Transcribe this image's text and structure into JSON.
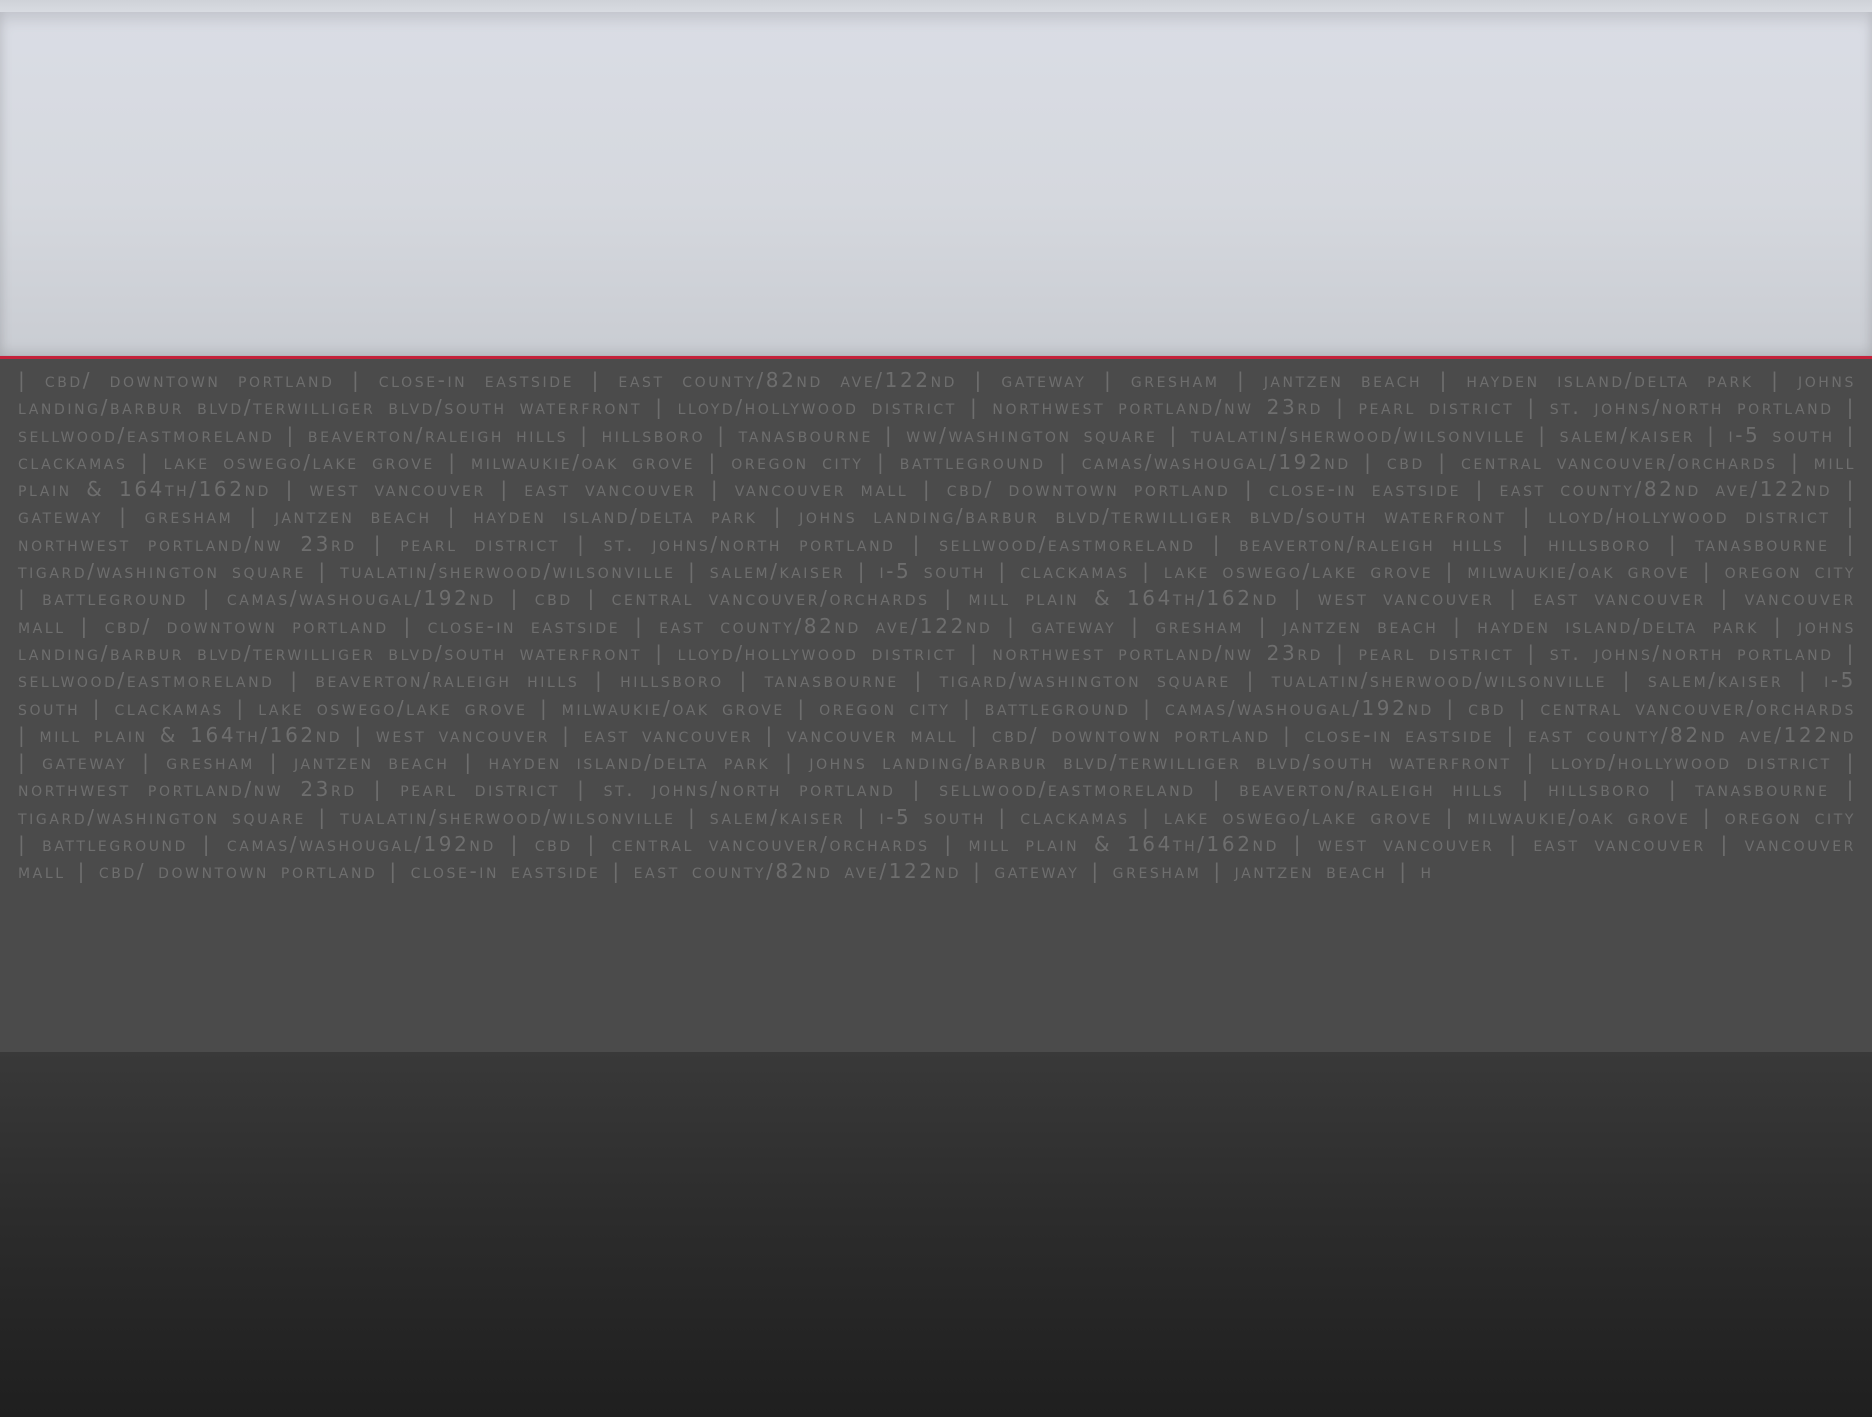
{
  "colors": {
    "header_background": "#d8dbe1",
    "accent_rule": "#c4213a",
    "panel_background": "#4b4b4b",
    "panel_text": "#6e6e6e",
    "footer_background": "#2b2b2b"
  },
  "neighborhoods": {
    "text": "| CBD/ DOWNTOWN PORTLAND | CLOSE-IN EASTSIDE | EAST COUNTY/82ND AVE/122ND | GATEWAY | GRESHAM | JANTZEN BEACH | HAYDEN ISLAND/DELTA PARK | JOHNS LANDING/BARBUR BLVD/TERWILLIGER BLVD/SOUTH WATERFRONT | LLOYD/HOLLYWOOD DISTRICT | NORTHWEST PORTLAND/NW 23RD | PEARL DISTRICT | ST. JOHNS/NORTH PORTLAND | SELLWOOD/EASTMORELAND | BEAVERTON/RALEIGH HILLS | HILLSBORO | TANASBOURNE | WW/WASHINGTON SQUARE | TUALATIN/SHERWOOD/WILSONVILLE | SALEM/KAISER | I-5 SOUTH | CLACKAMAS | LAKE OSWEGO/LAKE GROVE | MILWAUKIE/OAK GROVE | OREGON CITY | BATTLEGROUND | CAMAS/WASHOUGAL/192ND | CBD | CENTRAL VANCOUVER/ORCHARDS | MILL PLAIN & 164TH/162ND | WEST VANCOUVER | EAST VANCOUVER | VANCOUVER MALL | CBD/ DOWNTOWN PORTLAND | CLOSE-IN EASTSIDE | EAST COUNTY/82ND AVE/122ND | GATEWAY | GRESHAM | JANTZEN BEACH | HAYDEN ISLAND/DELTA PARK | JOHNS LANDING/BARBUR BLVD/TERWILLIGER BLVD/SOUTH WATERFRONT | LLOYD/HOLLYWOOD DISTRICT | NORTHWEST PORTLAND/NW 23RD | PEARL DISTRICT | ST. JOHNS/NORTH PORTLAND | SELLWOOD/EASTMORELAND | BEAVERTON/RALEIGH HILLS | HILLSBORO | TANASBOURNE | TIGARD/WASHINGTON SQUARE | TUALATIN/SHERWOOD/WILSONVILLE | SALEM/KAISER | I-5 SOUTH | CLACKAMAS | LAKE OSWEGO/LAKE GROVE | MILWAUKIE/OAK GROVE | OREGON CITY | BATTLEGROUND | CAMAS/WASHOUGAL/192ND | CBD | CENTRAL VANCOUVER/ORCHARDS | MILL PLAIN & 164TH/162ND | WEST VANCOUVER | EAST VANCOUVER | VANCOUVER MALL | CBD/ DOWNTOWN PORTLAND | CLOSE-IN EASTSIDE | EAST COUNTY/82ND AVE/122ND | GATEWAY | GRESHAM | JANTZEN BEACH | HAYDEN ISLAND/DELTA PARK | JOHNS LANDING/BARBUR BLVD/TERWILLIGER BLVD/SOUTH WATERFRONT | LLOYD/HOLLYWOOD DISTRICT | NORTHWEST PORTLAND/NW 23RD | PEARL DISTRICT | ST. JOHNS/NORTH PORTLAND | SELLWOOD/EASTMORELAND | BEAVERTON/RALEIGH HILLS | HILLSBORO | TANASBOURNE | TIGARD/WASHINGTON SQUARE | TUALATIN/SHERWOOD/WILSONVILLE | SALEM/KAISER | I-5 SOUTH | CLACKAMAS | LAKE OSWEGO/LAKE GROVE | MILWAUKIE/OAK GROVE | OREGON CITY | BATTLEGROUND | CAMAS/WASHOUGAL/192ND | CBD | CENTRAL VANCOUVER/ORCHARDS | MILL PLAIN & 164TH/162ND | WEST VANCOUVER | EAST VANCOUVER | VANCOUVER MALL | CBD/ DOWNTOWN PORTLAND | CLOSE-IN EASTSIDE | EAST COUNTY/82ND AVE/122ND | GATEWAY | GRESHAM | JANTZEN BEACH | HAYDEN ISLAND/DELTA PARK | JOHNS LANDING/BARBUR BLVD/TERWILLIGER BLVD/SOUTH WATERFRONT | LLOYD/HOLLYWOOD DISTRICT | NORTHWEST PORTLAND/NW 23RD | PEARL DISTRICT | ST. JOHNS/NORTH PORTLAND | SELLWOOD/EASTMORELAND | BEAVERTON/RALEIGH HILLS | HILLSBORO | TANASBOURNE | TIGARD/WASHINGTON SQUARE | TUALATIN/SHERWOOD/WILSONVILLE | SALEM/KAISER | I-5 SOUTH | CLACKAMAS | LAKE OSWEGO/LAKE GROVE | MILWAUKIE/OAK GROVE | OREGON CITY | BATTLEGROUND | CAMAS/WASHOUGAL/192ND | CBD | CENTRAL VANCOUVER/ORCHARDS | MILL PLAIN & 164TH/162ND | WEST VANCOUVER | EAST VANCOUVER | VANCOUVER MALL | CBD/ DOWNTOWN PORTLAND | CLOSE-IN EASTSIDE | EAST COUNTY/82ND AVE/122ND | GATEWAY | GRESHAM | JANTZEN BEACH | H"
  }
}
